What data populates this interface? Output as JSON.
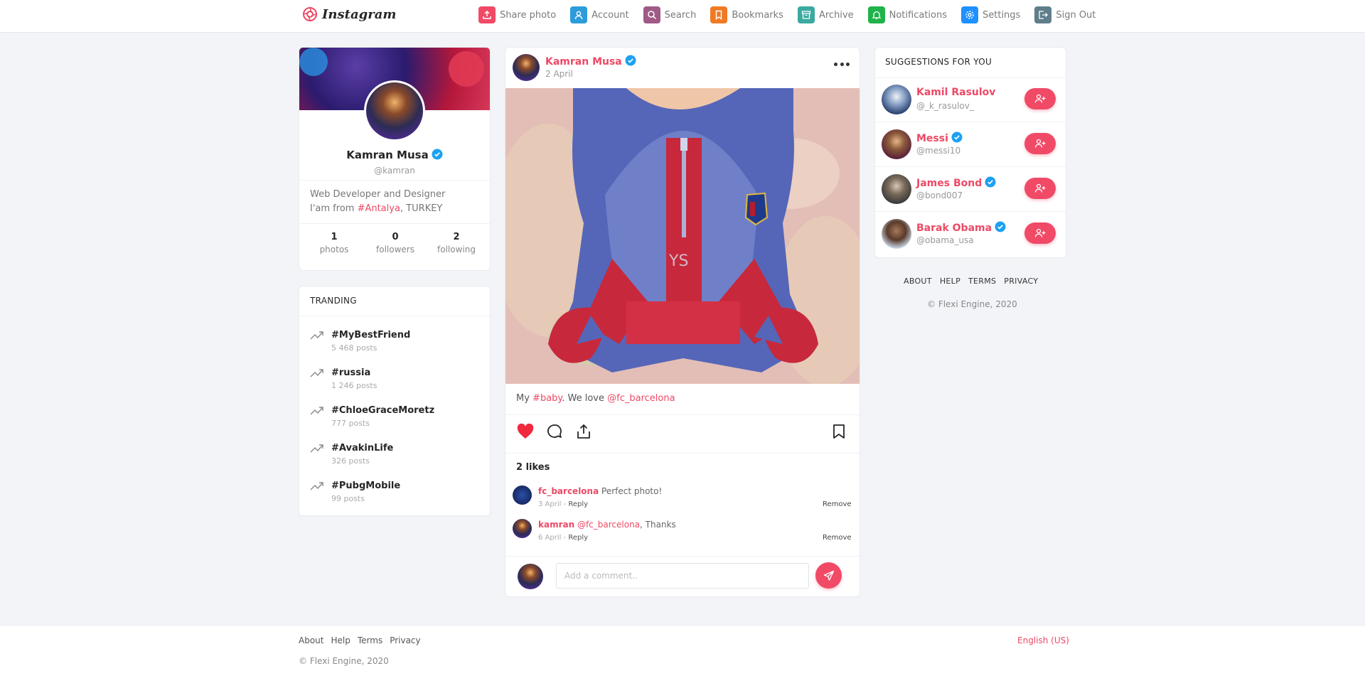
{
  "app": {
    "logo_text": "Instagram",
    "accent_color": "#ed4966"
  },
  "nav": {
    "items": [
      {
        "label": "Share photo",
        "icon": "upload-icon",
        "color": "#f04a66"
      },
      {
        "label": "Account",
        "icon": "user-icon",
        "color": "#2d9cdb"
      },
      {
        "label": "Search",
        "icon": "search-icon",
        "color": "#a05a86"
      },
      {
        "label": "Bookmarks",
        "icon": "bookmark-icon",
        "color": "#f07a24"
      },
      {
        "label": "Archive",
        "icon": "archive-icon",
        "color": "#3aa99f"
      },
      {
        "label": "Notifications",
        "icon": "bell-icon",
        "color": "#1fb34a"
      },
      {
        "label": "Settings",
        "icon": "gear-icon",
        "color": "#1e90ff"
      },
      {
        "label": "Sign Out",
        "icon": "signout-icon",
        "color": "#5f7e8a"
      }
    ]
  },
  "profile": {
    "name": "Kamran Musa",
    "handle": "@kamran",
    "bio_line1": "Web Developer and Designer",
    "bio_prefix": "I'am from ",
    "bio_link": "#Antalya",
    "bio_suffix": ", TURKEY",
    "stats": [
      {
        "value": "1",
        "label": "photos"
      },
      {
        "value": "0",
        "label": "followers"
      },
      {
        "value": "2",
        "label": "following"
      }
    ]
  },
  "trending": {
    "title": "TRANDING",
    "items": [
      {
        "tag": "#MyBestFriend",
        "count": "5 468 posts"
      },
      {
        "tag": "#russia",
        "count": "1 246 posts"
      },
      {
        "tag": "#ChloeGraceMoretz",
        "count": "777 posts"
      },
      {
        "tag": "#AvakinLife",
        "count": "326 posts"
      },
      {
        "tag": "#PubgMobile",
        "count": "99 posts"
      }
    ]
  },
  "post": {
    "author": "Kamran Musa",
    "date": "2 April",
    "caption_prefix": "My ",
    "caption_hashtag": "#baby",
    "caption_middle": ". We love ",
    "caption_mention": "@fc_barcelona",
    "likes": "2 likes",
    "comments": [
      {
        "user": "fc_barcelona",
        "mention": "",
        "text": " Perfect photo!",
        "date": "3 April",
        "reply": "Reply",
        "remove": "Remove"
      },
      {
        "user": "kamran",
        "mention": " @fc_barcelona",
        "text": ", Thanks",
        "date": "6 April",
        "reply": "Reply",
        "remove": "Remove"
      }
    ],
    "comment_placeholder": "Add a comment.."
  },
  "suggestions": {
    "title": "SUGGESTIONS FOR YOU",
    "items": [
      {
        "name": "Kamil Rasulov",
        "handle": "@_k_rasulov_",
        "verified": false
      },
      {
        "name": "Messi",
        "handle": "@messi10",
        "verified": true
      },
      {
        "name": "James Bond",
        "handle": "@bond007",
        "verified": true
      },
      {
        "name": "Barak Obama",
        "handle": "@obama_usa",
        "verified": true
      }
    ]
  },
  "side_links": [
    "ABOUT",
    "HELP",
    "TERMS",
    "PRIVACY"
  ],
  "side_copyright": "© Flexi Engine, 2020",
  "footer": {
    "links": [
      "About",
      "Help",
      "Terms",
      "Privacy"
    ],
    "copyright": "© Flexi Engine, 2020",
    "language": "English (US)"
  }
}
